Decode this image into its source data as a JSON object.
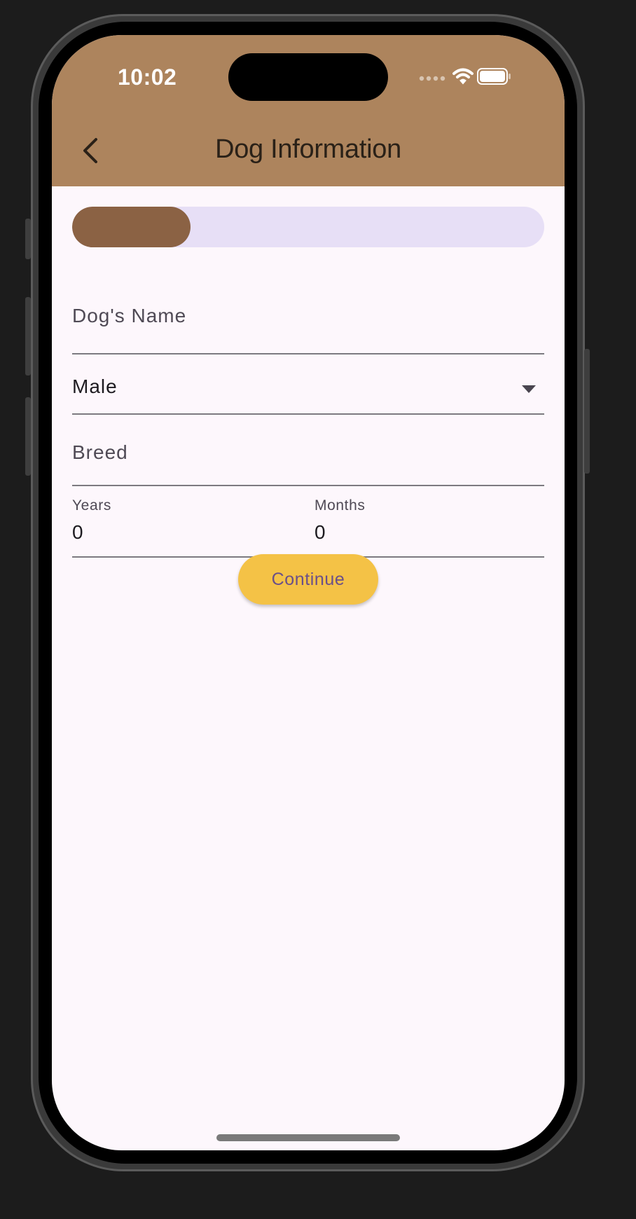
{
  "status_bar": {
    "time": "10:02"
  },
  "header": {
    "title": "Dog Information"
  },
  "progress": {
    "fraction": 0.25
  },
  "form": {
    "dog_name": {
      "label": "Dog's Name",
      "value": ""
    },
    "gender": {
      "selected": "Male"
    },
    "breed": {
      "label": "Breed",
      "value": ""
    },
    "years": {
      "label": "Years",
      "value": "0"
    },
    "months": {
      "label": "Months",
      "value": "0"
    }
  },
  "actions": {
    "continue_label": "Continue"
  },
  "icons": {
    "back": "chevron-left-icon",
    "dropdown": "caret-down-icon",
    "signal": "signal-dots-icon",
    "wifi": "wifi-icon",
    "battery": "battery-icon"
  },
  "colors": {
    "app_bar": "#ad845d",
    "progress_fill": "#8b6244",
    "progress_track": "#e7dff6",
    "button": "#f4c246",
    "button_text": "#6a4f89",
    "background": "#fdf7fc"
  }
}
